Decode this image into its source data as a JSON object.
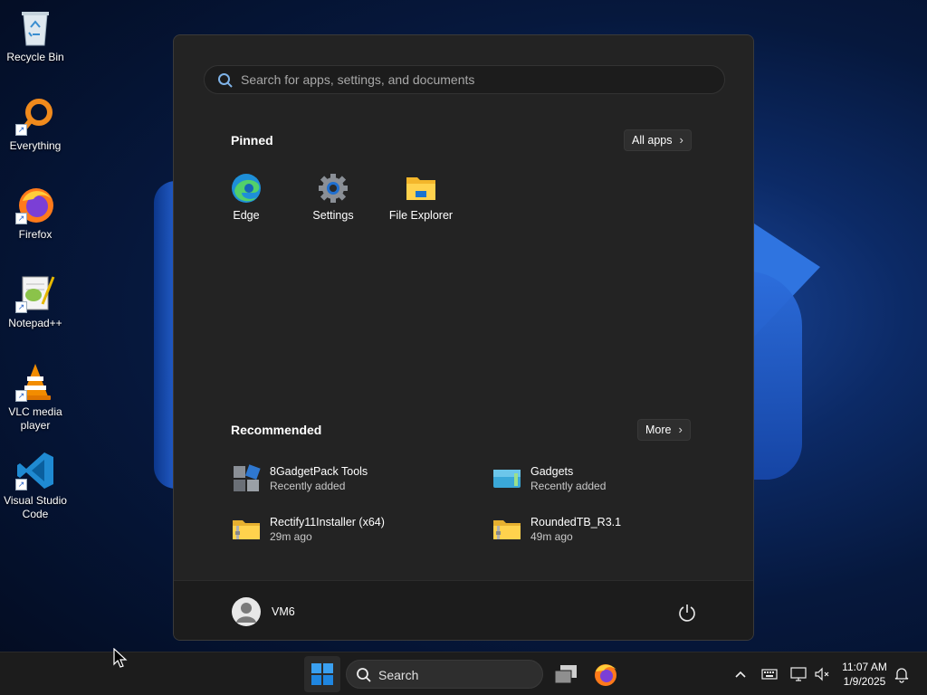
{
  "desktop": {
    "icons": [
      {
        "label": "Recycle Bin",
        "icon": "recycle-bin-icon"
      },
      {
        "label": "Everything",
        "icon": "everything-search-icon"
      },
      {
        "label": "Firefox",
        "icon": "firefox-icon"
      },
      {
        "label": "Notepad++",
        "icon": "notepad-plus-plus-icon"
      },
      {
        "label": "VLC media player",
        "icon": "vlc-icon"
      },
      {
        "label": "Visual Studio Code",
        "icon": "vscode-icon"
      }
    ]
  },
  "start_menu": {
    "search_placeholder": "Search for apps, settings, and documents",
    "pinned_title": "Pinned",
    "all_apps_label": "All apps",
    "pinned": [
      {
        "label": "Edge",
        "icon": "edge-icon"
      },
      {
        "label": "Settings",
        "icon": "settings-gear-icon"
      },
      {
        "label": "File Explorer",
        "icon": "file-explorer-icon"
      }
    ],
    "recommended_title": "Recommended",
    "more_label": "More",
    "recommended": [
      {
        "name": "8GadgetPack Tools",
        "sub": "Recently added",
        "icon": "gadgetpack-tools-icon"
      },
      {
        "name": "Gadgets",
        "sub": "Recently added",
        "icon": "gadgets-icon"
      },
      {
        "name": "Rectify11Installer (x64)",
        "sub": "29m ago",
        "icon": "zip-folder-icon"
      },
      {
        "name": "RoundedTB_R3.1",
        "sub": "49m ago",
        "icon": "zip-folder-icon"
      }
    ],
    "user_name": "VM6"
  },
  "taskbar": {
    "search_label": "Search",
    "time": "11:07 AM",
    "date": "1/9/2025"
  },
  "colors": {
    "accent": "#0067c0",
    "menu_bg": "#232323",
    "taskbar_bg": "#1c1c1c"
  }
}
